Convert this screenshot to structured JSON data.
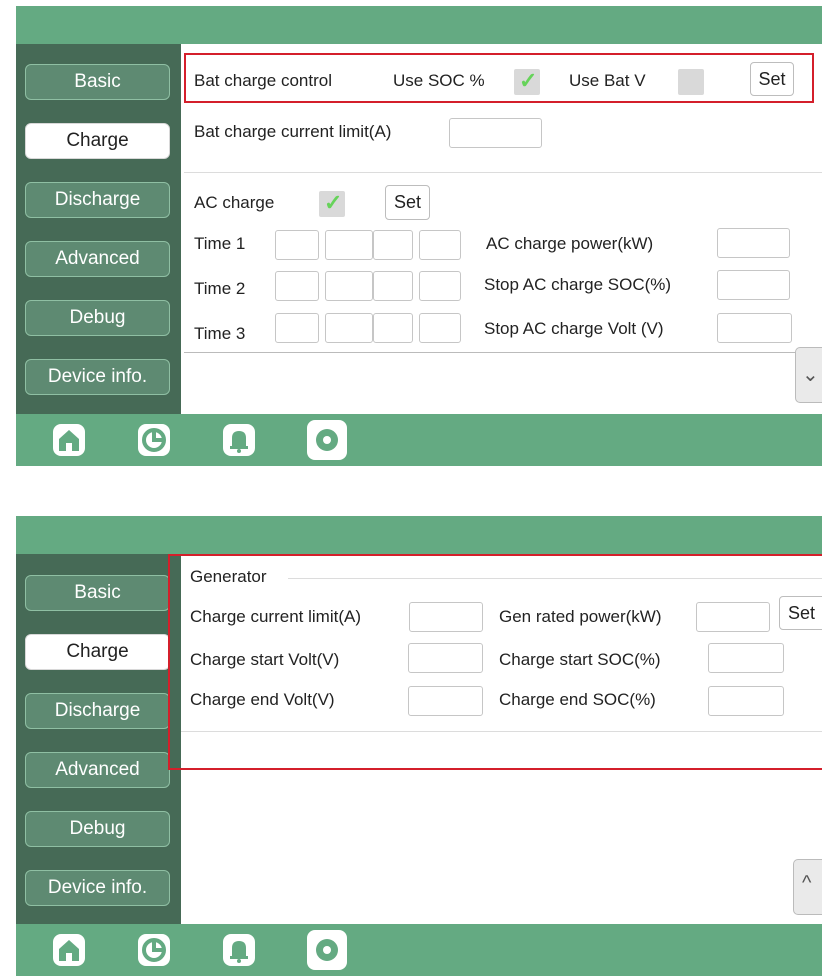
{
  "nav": {
    "basic": "Basic",
    "charge": "Charge",
    "discharge": "Discharge",
    "advanced": "Advanced",
    "debug": "Debug",
    "device_info": "Device info."
  },
  "panel1": {
    "bat_charge_control": "Bat charge control",
    "use_soc": "Use SOC %",
    "use_soc_checked": true,
    "use_bat_v": "Use Bat V",
    "use_bat_v_checked": false,
    "set": "Set",
    "bat_charge_current_limit": "Bat charge current limit(A)",
    "ac_charge": "AC charge",
    "ac_charge_checked": true,
    "ac_set": "Set",
    "time1": "Time  1",
    "time2": "Time  2",
    "time3": "Time  3",
    "ac_charge_power": "AC charge power(kW)",
    "stop_ac_charge_soc": "Stop AC charge SOC(%)",
    "stop_ac_charge_volt": "Stop AC charge Volt (V)"
  },
  "panel2": {
    "generator": "Generator",
    "charge_current_limit": "Charge current limit(A)",
    "gen_rated_power": "Gen rated power(kW)",
    "set": "Set",
    "charge_start_volt": "Charge start Volt(V)",
    "charge_start_soc": "Charge start SOC(%)",
    "charge_end_volt": "Charge end Volt(V)",
    "charge_end_soc": "Charge end SOC(%)"
  },
  "icons": [
    "home-icon",
    "pie-chart-icon",
    "bell-icon",
    "settings-gear-icon"
  ],
  "colors": {
    "bar_green": "#64aa82",
    "sidebar_green": "#466a56",
    "highlight_red": "#d41f2b",
    "check_green": "#66d35a"
  }
}
